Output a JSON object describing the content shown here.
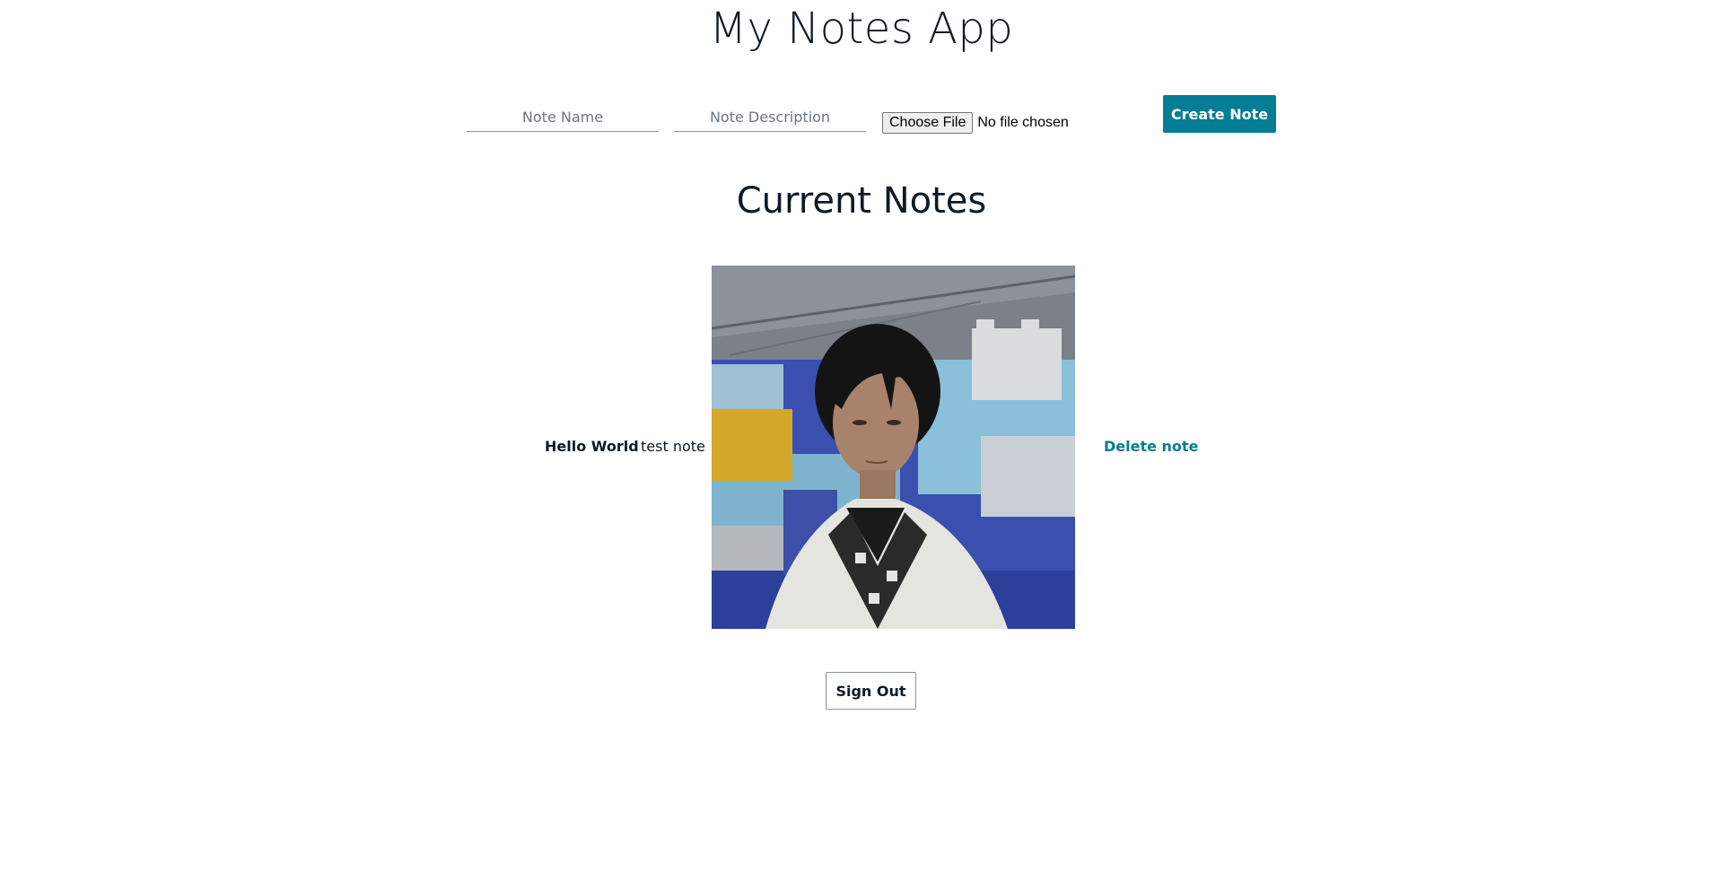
{
  "app": {
    "title": "My Notes App"
  },
  "form": {
    "name_placeholder": "Note Name",
    "name_value": "",
    "description_placeholder": "Note Description",
    "description_value": "",
    "choose_file_label": "Choose File",
    "file_status": "No file chosen",
    "create_label": "Create Note"
  },
  "notes_section": {
    "title": "Current Notes",
    "notes": [
      {
        "name": "Hello World",
        "description": "test note",
        "delete_label": "Delete note"
      }
    ]
  },
  "footer": {
    "sign_out_label": "Sign Out"
  },
  "colors": {
    "accent": "#047d95",
    "text": "#0d1a26",
    "border": "#89949f"
  }
}
